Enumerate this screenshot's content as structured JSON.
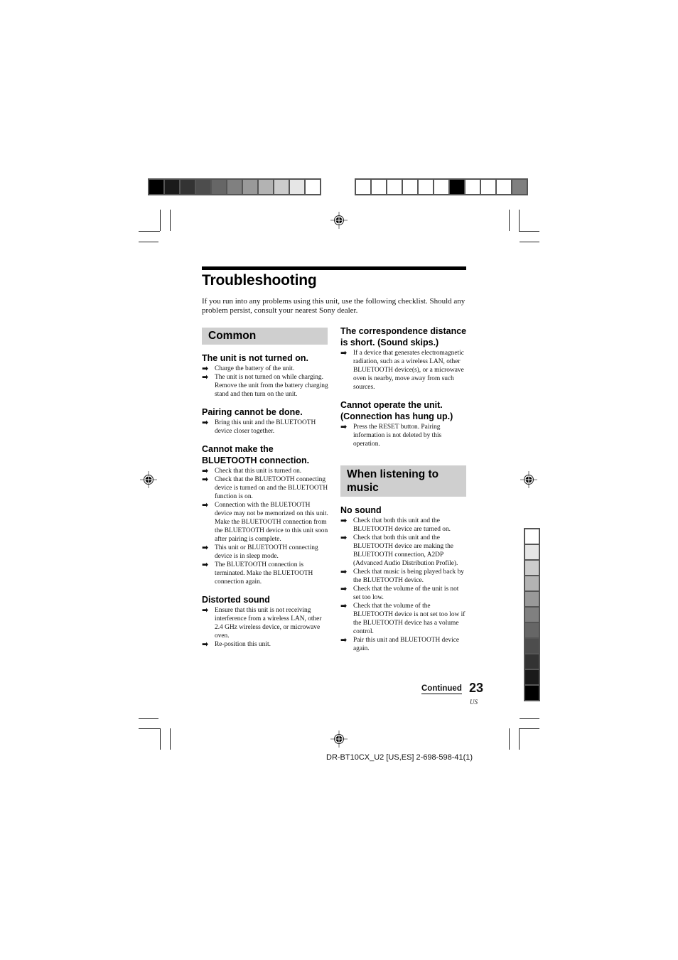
{
  "color_bars": {
    "top_left": [
      "#000000",
      "#1a1a1a",
      "#333333",
      "#4d4d4d",
      "#666666",
      "#808080",
      "#999999",
      "#b3b3b3",
      "#cccccc",
      "#e6e6e6",
      "#ffffff"
    ],
    "top_right": [
      "#ffffff",
      "#ffffff",
      "#ffffff",
      "#ffffff",
      "#ffffff",
      "#ffffff",
      "#000000",
      "#ffffff",
      "#ffffff",
      "#ffffff",
      "#808080"
    ],
    "side": [
      "#ffffff",
      "#e6e6e6",
      "#cccccc",
      "#b3b3b3",
      "#999999",
      "#808080",
      "#666666",
      "#4d4d4d",
      "#333333",
      "#1a1a1a",
      "#000000"
    ]
  },
  "page": {
    "title": "Troubleshooting",
    "intro": "If you run into any problems using this unit, use the following checklist. Should any problem persist, consult your nearest Sony dealer.",
    "arrow_icon": "➡",
    "sections": {
      "common": {
        "label": "Common",
        "groups": [
          {
            "heading": "The unit is not turned on.",
            "items": [
              "Charge the battery of the unit.",
              "The unit is not turned on while charging. Remove the unit from the battery charging stand and then turn on the unit."
            ]
          },
          {
            "heading": "Pairing cannot be done.",
            "items": [
              "Bring this unit and the BLUETOOTH device closer together."
            ]
          },
          {
            "heading": "Cannot make the BLUETOOTH connection.",
            "items": [
              "Check that this unit is turned on.",
              "Check that the BLUETOOTH connecting device is turned on and the BLUETOOTH function is on.",
              "Connection with the BLUETOOTH device may not be memorized on this unit. Make the BLUETOOTH connection from the BLUETOOTH device to this unit soon after pairing is complete.",
              "This unit or BLUETOOTH connecting device is in sleep mode.",
              "The BLUETOOTH connection is terminated. Make the BLUETOOTH connection again."
            ]
          },
          {
            "heading": "Distorted sound",
            "items": [
              "Ensure that this unit is not receiving interference from a wireless LAN, other 2.4 GHz wireless device, or microwave oven.",
              "Re-position this unit."
            ]
          },
          {
            "heading": "The correspondence distance is short. (Sound skips.)",
            "items": [
              "If a device that generates electromagnetic radiation, such as a wireless LAN, other BLUETOOTH device(s), or a microwave oven is nearby, move away from such sources."
            ]
          },
          {
            "heading": "Cannot operate the unit. (Connection has hung up.)",
            "items": [
              "Press the RESET button. Pairing information is not deleted by this operation."
            ]
          }
        ]
      },
      "music": {
        "label": "When listening to music",
        "groups": [
          {
            "heading": "No sound",
            "items": [
              "Check that both this unit and the BLUETOOTH device are turned on.",
              "Check that both this unit and the BLUETOOTH device are making the BLUETOOTH connection, A2DP (Advanced Audio Distribution Profile).",
              "Check that music is being played back by the BLUETOOTH device.",
              "Check that the volume of the unit is not set too low.",
              "Check that the volume of the BLUETOOTH device is not set too low if the BLUETOOTH device has a volume control.",
              "Pair this unit and BLUETOOTH device again."
            ]
          }
        ]
      }
    },
    "continued_label": "Continued",
    "page_number": "23",
    "page_suffix": "US"
  },
  "footer": {
    "code": "DR-BT10CX_U2 [US,ES] 2-698-598-41(1)"
  }
}
